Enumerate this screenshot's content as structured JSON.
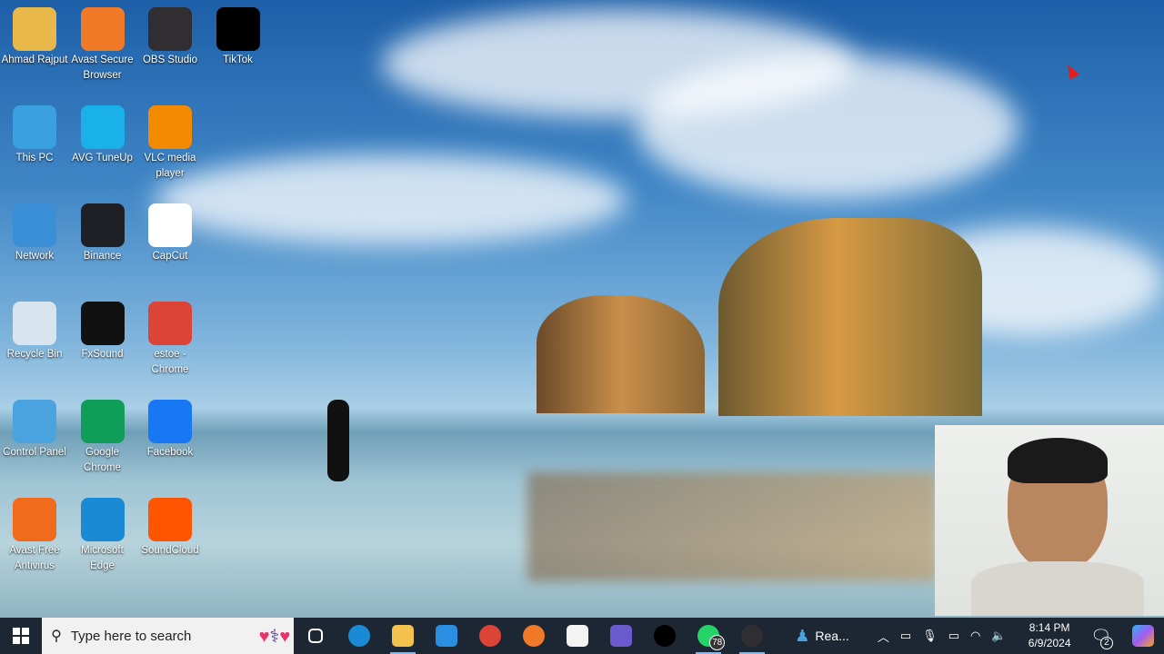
{
  "desktop_icons": [
    {
      "label": "Ahmad Rajput",
      "icon": "user-folder-icon",
      "color": "#e8b84a"
    },
    {
      "label": "Avast Secure Browser",
      "icon": "avast-browser-icon",
      "color": "#f07a28"
    },
    {
      "label": "OBS Studio",
      "icon": "obs-icon",
      "color": "#302e31"
    },
    {
      "label": "TikTok",
      "icon": "tiktok-icon",
      "color": "#000000"
    },
    {
      "label": "This PC",
      "icon": "computer-icon",
      "color": "#3aa0e0"
    },
    {
      "label": "AVG TuneUp",
      "icon": "avg-tuneup-icon",
      "color": "#1ab0e8"
    },
    {
      "label": "VLC media player",
      "icon": "vlc-icon",
      "color": "#f48a00"
    },
    {
      "label": "Network",
      "icon": "network-icon",
      "color": "#3b8fd6"
    },
    {
      "label": "Binance",
      "icon": "binance-icon",
      "color": "#1e2026"
    },
    {
      "label": "CapCut",
      "icon": "capcut-icon",
      "color": "#ffffff"
    },
    {
      "label": "Recycle Bin",
      "icon": "recycle-bin-icon",
      "color": "#d8e4ee"
    },
    {
      "label": "FxSound",
      "icon": "fxsound-icon",
      "color": "#111111"
    },
    {
      "label": "estoe - Chrome",
      "icon": "chrome-profile-icon",
      "color": "#db4437"
    },
    {
      "label": "Control Panel",
      "icon": "control-panel-icon",
      "color": "#4aa3df"
    },
    {
      "label": "Google Chrome",
      "icon": "chrome-icon",
      "color": "#0f9d58"
    },
    {
      "label": "Facebook",
      "icon": "facebook-icon",
      "color": "#1877f2"
    },
    {
      "label": "Avast Free Antivirus",
      "icon": "avast-antivirus-icon",
      "color": "#f26a1b"
    },
    {
      "label": "Microsoft Edge",
      "icon": "edge-icon",
      "color": "#1a8ad4"
    },
    {
      "label": "SoundCloud",
      "icon": "soundcloud-icon",
      "color": "#ff5500"
    }
  ],
  "taskbar": {
    "search_placeholder": "Type here to search",
    "apps": [
      {
        "name": "task-view",
        "color": "#ffffff"
      },
      {
        "name": "edge",
        "color": "#1a8ad4"
      },
      {
        "name": "file-explorer",
        "color": "#f2c14e"
      },
      {
        "name": "mail",
        "color": "#2a8fe0"
      },
      {
        "name": "chrome",
        "color": "#db4437"
      },
      {
        "name": "avast-browser",
        "color": "#f07a28"
      },
      {
        "name": "microsoft-store",
        "color": "#f3f3f3"
      },
      {
        "name": "copilot-app",
        "color": "#6a5acd"
      },
      {
        "name": "tiktok",
        "color": "#000000"
      },
      {
        "name": "whatsapp",
        "color": "#25d366"
      },
      {
        "name": "obs",
        "color": "#302e31"
      }
    ],
    "whatsapp_badge": "78",
    "running_app_label": "Rea...",
    "time": "8:14 PM",
    "date": "6/9/2024",
    "notification_count": "2"
  }
}
